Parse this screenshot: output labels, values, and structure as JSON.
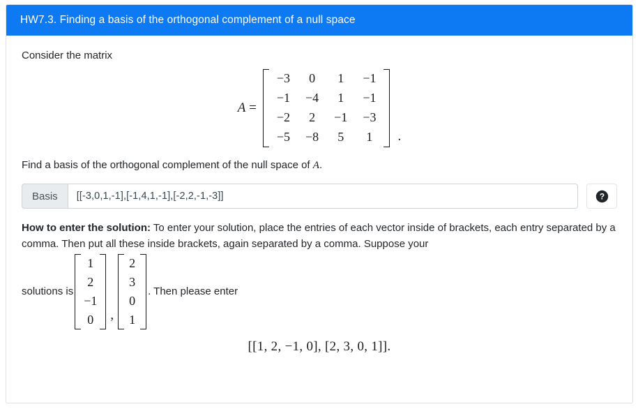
{
  "header": {
    "title": "HW7.3. Finding a basis of the orthogonal complement of a null space",
    "bg_color": "#0d79f2",
    "text_color": "#ffffff"
  },
  "body": {
    "intro": "Consider the matrix",
    "matrix_label": "A",
    "equals": "=",
    "matrix": [
      [
        "−3",
        "0",
        "1",
        "−1"
      ],
      [
        "−1",
        "−4",
        "1",
        "−1"
      ],
      [
        "−2",
        "2",
        "−1",
        "−3"
      ],
      [
        "−5",
        "−8",
        "5",
        "1"
      ]
    ],
    "matrix_trailing_period": ".",
    "prompt_before": "Find a basis of the orthogonal complement of the null space of ",
    "prompt_symbol": "A",
    "prompt_after": "."
  },
  "answer": {
    "label": "Basis",
    "value": "[[-3,0,1,-1],[-1,4,1,-1],[-2,2,-1,-3]]",
    "placeholder": "",
    "help_icon": "question-mark-circle-icon",
    "help_icon_color": "#212529"
  },
  "howto": {
    "title": "How to enter the solution:",
    "text": " To enter your solution, place the entries of each vector inside of brackets, each entry separated by a comma. Then put all these inside brackets, again separated by a comma. Suppose your",
    "lead_in": "solutions is",
    "vector_one": [
      "1",
      "2",
      "−1",
      "0"
    ],
    "separator": ",",
    "vector_two": [
      "2",
      "3",
      "0",
      "1"
    ],
    "tail": ". Then please enter",
    "final_expression": "[[1, 2, −1, 0], [2, 3, 0, 1]]."
  }
}
